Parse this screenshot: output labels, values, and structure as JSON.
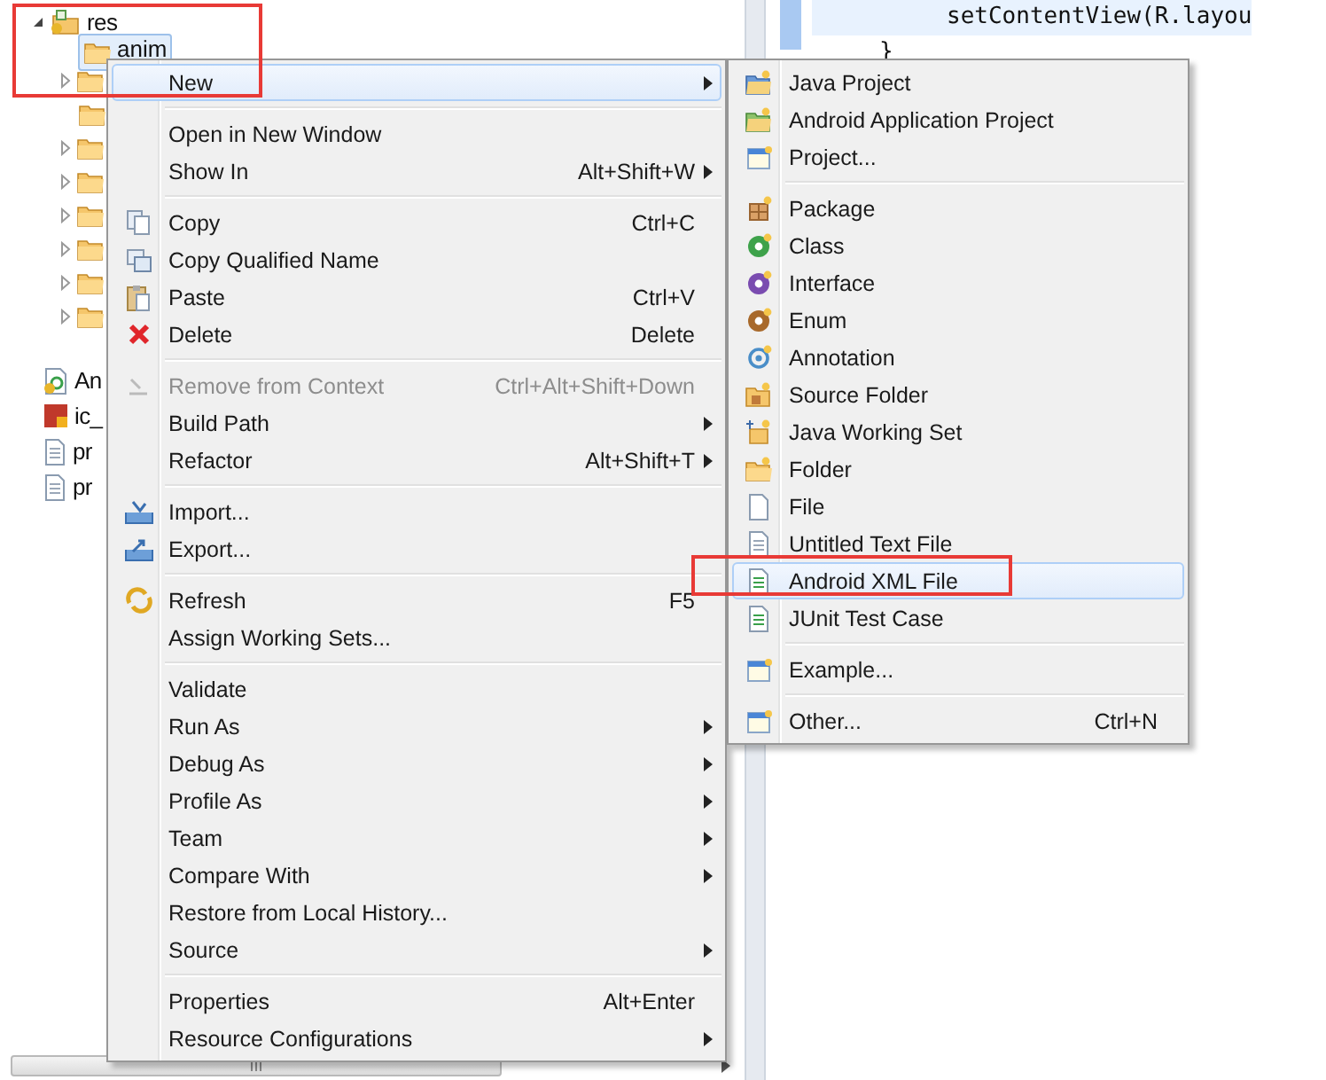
{
  "tree": [
    {
      "label": "res",
      "expanded": true,
      "children": [
        {
          "label": "anim",
          "selected": true
        },
        {
          "expandable": true
        },
        {
          "expandable": false
        },
        {
          "expandable": true
        },
        {
          "expandable": true
        },
        {
          "expandable": true
        },
        {
          "expandable": true
        },
        {
          "expandable": true
        },
        {
          "expandable": true
        }
      ]
    },
    {
      "label": "An"
    },
    {
      "label": "ic_"
    },
    {
      "label": "pr"
    },
    {
      "label": "pr"
    }
  ],
  "editor": {
    "lines": [
      "setContentView(R.layou",
      "}"
    ]
  },
  "context_menu": {
    "groups": [
      [
        {
          "label": "New",
          "submenu": true,
          "selected": true
        }
      ],
      [
        {
          "label": "Open in New Window",
          "submenu": false,
          "selected": false
        },
        {
          "label": "Show In",
          "shortcut": "Alt+Shift+W",
          "submenu": true,
          "selected": false
        }
      ],
      [
        {
          "label": "Copy",
          "shortcut": "Ctrl+C",
          "submenu": false,
          "selected": false
        },
        {
          "label": "Copy Qualified Name",
          "submenu": false,
          "selected": false
        },
        {
          "label": "Paste",
          "shortcut": "Ctrl+V",
          "submenu": false,
          "selected": false
        },
        {
          "label": "Delete",
          "shortcut": "Delete",
          "submenu": false,
          "selected": false
        }
      ],
      [
        {
          "label": "Remove from Context",
          "shortcut": "Ctrl+Alt+Shift+Down",
          "submenu": false,
          "selected": false,
          "disabled": true
        },
        {
          "label": "Build Path",
          "submenu": true,
          "selected": false
        },
        {
          "label": "Refactor",
          "shortcut": "Alt+Shift+T",
          "submenu": true,
          "selected": false
        }
      ],
      [
        {
          "label": "Import...",
          "submenu": false,
          "selected": false
        },
        {
          "label": "Export...",
          "submenu": false,
          "selected": false
        }
      ],
      [
        {
          "label": "Refresh",
          "shortcut": "F5",
          "submenu": false,
          "selected": false
        },
        {
          "label": "Assign Working Sets...",
          "submenu": false,
          "selected": false
        }
      ],
      [
        {
          "label": "Validate",
          "submenu": false,
          "selected": false
        },
        {
          "label": "Run As",
          "submenu": true,
          "selected": false
        },
        {
          "label": "Debug As",
          "submenu": true,
          "selected": false
        },
        {
          "label": "Profile As",
          "submenu": true,
          "selected": false
        },
        {
          "label": "Team",
          "submenu": true,
          "selected": false
        },
        {
          "label": "Compare With",
          "submenu": true,
          "selected": false
        },
        {
          "label": "Restore from Local History...",
          "submenu": false,
          "selected": false
        },
        {
          "label": "Source",
          "submenu": true,
          "selected": false
        }
      ],
      [
        {
          "label": "Properties",
          "shortcut": "Alt+Enter",
          "submenu": false,
          "selected": false
        },
        {
          "label": "Resource Configurations",
          "submenu": true,
          "selected": false
        }
      ]
    ]
  },
  "new_submenu": {
    "groups": [
      [
        {
          "label": "Java Project",
          "selected": false
        },
        {
          "label": "Android Application Project",
          "selected": false
        },
        {
          "label": "Project...",
          "selected": false
        }
      ],
      [
        {
          "label": "Package",
          "selected": false
        },
        {
          "label": "Class",
          "selected": false
        },
        {
          "label": "Interface",
          "selected": false
        },
        {
          "label": "Enum",
          "selected": false
        },
        {
          "label": "Annotation",
          "selected": false
        },
        {
          "label": "Source Folder",
          "selected": false
        },
        {
          "label": "Java Working Set",
          "selected": false
        },
        {
          "label": "Folder",
          "selected": false
        },
        {
          "label": "File",
          "selected": false
        },
        {
          "label": "Untitled Text File",
          "selected": false
        },
        {
          "label": "Android XML File",
          "selected": true
        },
        {
          "label": "JUnit Test Case",
          "selected": false
        }
      ],
      [
        {
          "label": "Example...",
          "selected": false
        }
      ],
      [
        {
          "label": "Other...",
          "shortcut": "Ctrl+N",
          "selected": false
        }
      ]
    ]
  }
}
